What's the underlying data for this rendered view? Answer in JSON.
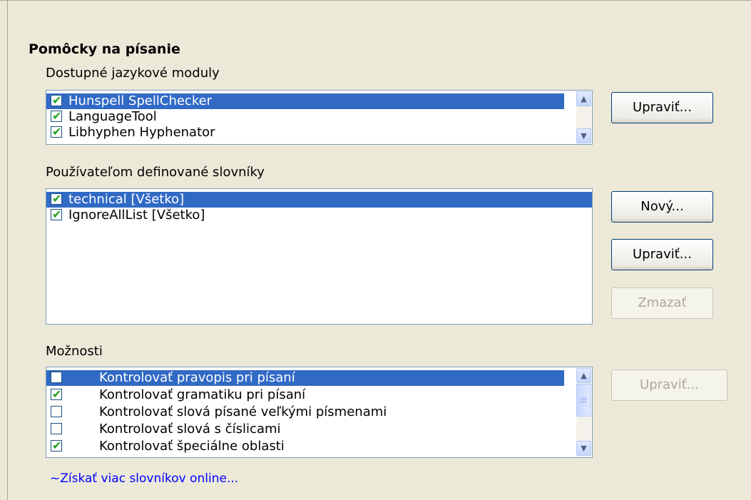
{
  "section_title": "Pomôcky na písanie",
  "modules": {
    "label": "Dostupné jazykové moduly",
    "items": [
      {
        "label": "Hunspell SpellChecker",
        "checked": true,
        "selected": true
      },
      {
        "label": "LanguageTool",
        "checked": true,
        "selected": false
      },
      {
        "label": "Libhyphen Hyphenator",
        "checked": true,
        "selected": false
      }
    ],
    "edit_button": "Upraviť..."
  },
  "dictionaries": {
    "label": "Používateľom definované slovníky",
    "items": [
      {
        "label": "technical [Všetko]",
        "checked": true,
        "selected": true
      },
      {
        "label": "IgnoreAllList [Všetko]",
        "checked": true,
        "selected": false
      }
    ],
    "new_button": "Nový...",
    "edit_button": "Upraviť...",
    "delete_button": "Zmazať"
  },
  "options": {
    "label": "Možnosti",
    "items": [
      {
        "label": "Kontrolovať pravopis pri písaní",
        "checked": false,
        "selected": true
      },
      {
        "label": "Kontrolovať gramatiku pri písaní",
        "checked": true,
        "selected": false
      },
      {
        "label": "Kontrolovať slová písané veľkými písmenami",
        "checked": false,
        "selected": false
      },
      {
        "label": "Kontrolovať slová s číslicami",
        "checked": false,
        "selected": false
      },
      {
        "label": "Kontrolovať špeciálne oblasti",
        "checked": true,
        "selected": false
      }
    ],
    "edit_button": "Upraviť..."
  },
  "online_link": "~Získať viac slovníkov online...",
  "colors": {
    "selection": "#316AC5",
    "check": "#21A121",
    "link": "#0000FF",
    "dialog_bg": "#ECE9D8"
  },
  "icons": {
    "scroll_up": "chevron-up-icon",
    "scroll_down": "chevron-down-icon",
    "checkbox": "checkmark-icon"
  }
}
